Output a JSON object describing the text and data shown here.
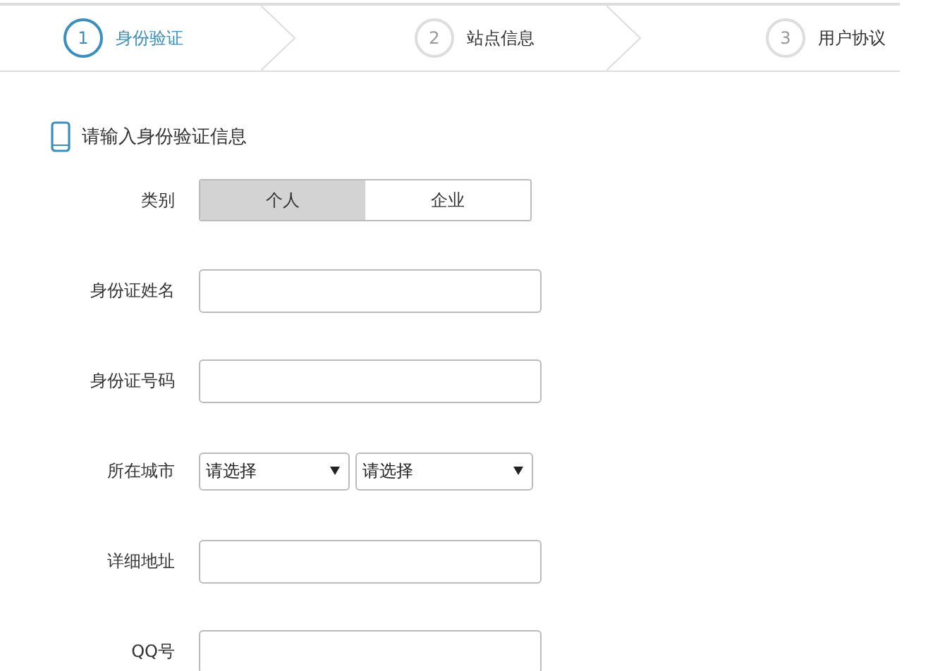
{
  "steps": [
    {
      "number": "1",
      "label": "身份验证",
      "selected": true
    },
    {
      "number": "2",
      "label": "站点信息",
      "selected": false
    },
    {
      "number": "3",
      "label": "用户协议",
      "selected": false
    }
  ],
  "heading": "请输入身份验证信息",
  "fields": [
    {
      "kind": "toggle",
      "label": "类别",
      "options": [
        {
          "label": "个人",
          "selected": true
        },
        {
          "label": "企业",
          "selected": false
        }
      ]
    },
    {
      "kind": "text",
      "label": "身份证姓名"
    },
    {
      "kind": "text",
      "label": "身份证号码"
    },
    {
      "kind": "select",
      "label": "所在城市",
      "selects": [
        {
          "value": "请选择"
        },
        {
          "value": "请选择"
        }
      ]
    },
    {
      "kind": "text",
      "label": "详细地址"
    },
    {
      "kind": "text",
      "label": "QQ号"
    }
  ]
}
